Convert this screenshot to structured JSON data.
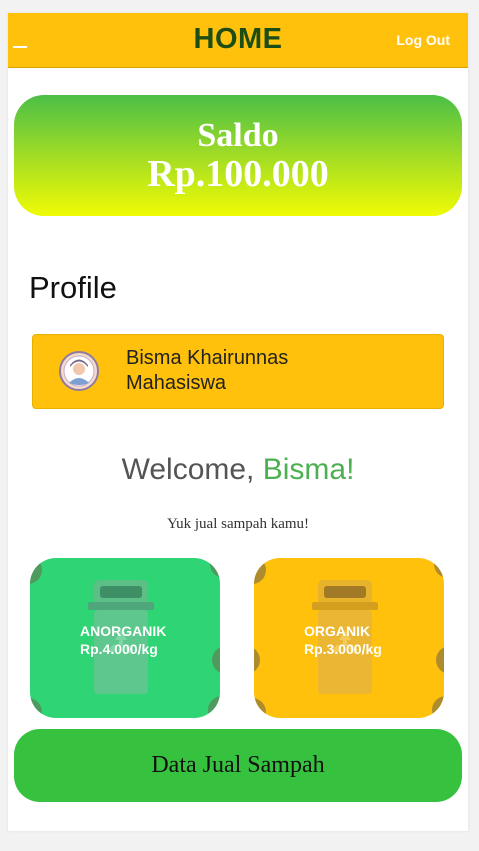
{
  "header": {
    "title": "HOME",
    "logout_label": "Log Out",
    "menu_icon": "menu-icon"
  },
  "balance": {
    "label": "Saldo",
    "amount": "Rp.100.000"
  },
  "profile": {
    "heading": "Profile",
    "name": "Bisma Khairunnas",
    "role": "Mahasiswa",
    "avatar_icon": "user-avatar-icon"
  },
  "welcome": {
    "prefix": "Welcome, ",
    "name": "Bisma!",
    "subtitle": "Yuk jual sampah kamu!"
  },
  "categories": [
    {
      "label": "ANORGANIK",
      "price": "Rp.4.000/kg",
      "color": "#2fd574",
      "icon": "recycle-bin-icon"
    },
    {
      "label": "ORGANIK",
      "price": "Rp.3.000/kg",
      "color": "#ffc10b",
      "icon": "recycle-bin-icon"
    }
  ],
  "actions": {
    "data_button": "Data Jual Sampah"
  },
  "colors": {
    "accent": "#ffc10b",
    "title": "#1b4d14",
    "button": "#36c13f",
    "welcome_name": "#4caf50"
  }
}
